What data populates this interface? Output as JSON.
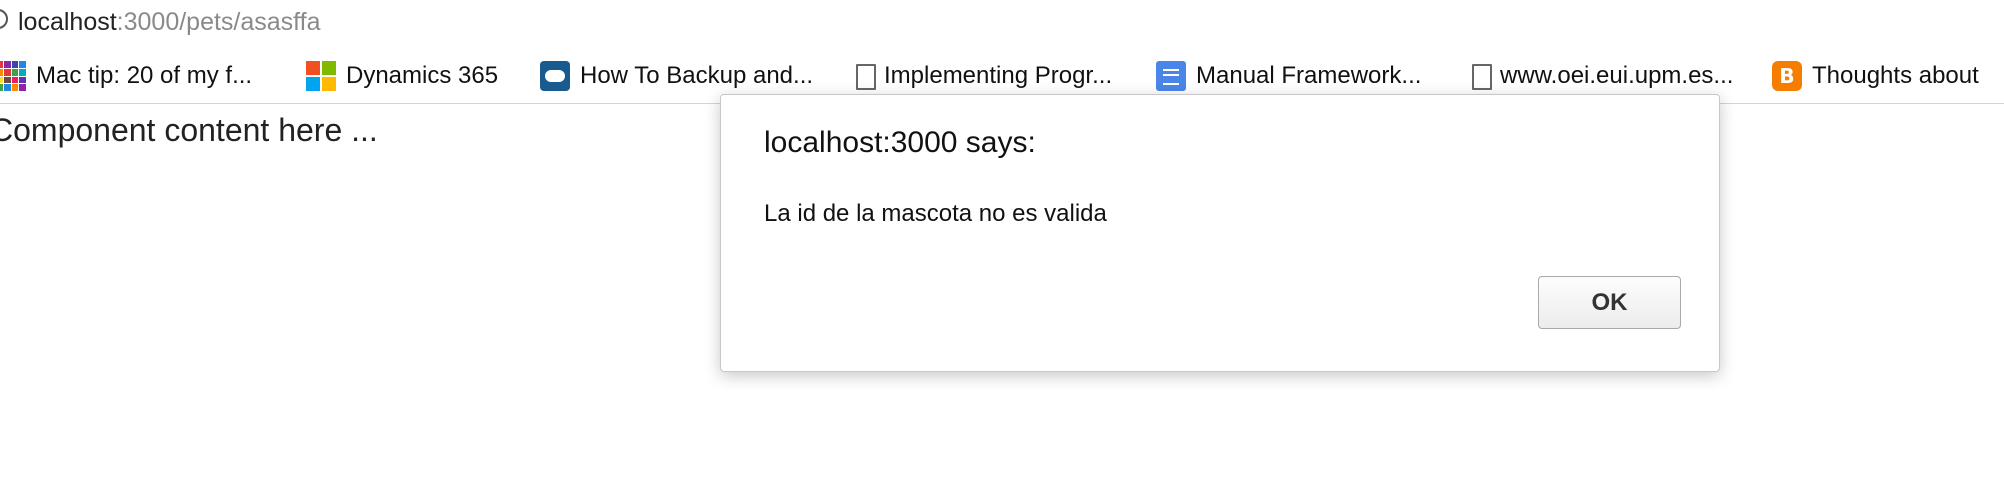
{
  "address_bar": {
    "url_host": "localhost",
    "url_path": ":3000/pets/asasffa"
  },
  "bookmarks": [
    {
      "label": "Mac tip: 20 of my f...",
      "icon": "app-grid-icon"
    },
    {
      "label": "Dynamics 365",
      "icon": "microsoft-logo-icon"
    },
    {
      "label": "How To Backup and...",
      "icon": "cloud-icon"
    },
    {
      "label": "Implementing Progr...",
      "icon": "document-icon"
    },
    {
      "label": "Manual Framework...",
      "icon": "google-docs-icon"
    },
    {
      "label": "www.oei.eui.upm.es...",
      "icon": "document-icon"
    },
    {
      "label": "Thoughts about",
      "icon": "blogger-icon"
    }
  ],
  "page": {
    "content_text": "Component content here ..."
  },
  "dialog": {
    "title": "localhost:3000 says:",
    "message": "La id de la mascota no es valida",
    "ok_label": "OK"
  },
  "colors": {
    "url_path": "#8a8a8a",
    "cloud_icon": "#1a5b8f",
    "google_docs_icon": "#4a86e8",
    "blogger_icon": "#f57d00",
    "microsoft_red": "#f25022",
    "microsoft_green": "#7fba00",
    "microsoft_blue": "#00a4ef",
    "microsoft_yellow": "#ffb900"
  }
}
